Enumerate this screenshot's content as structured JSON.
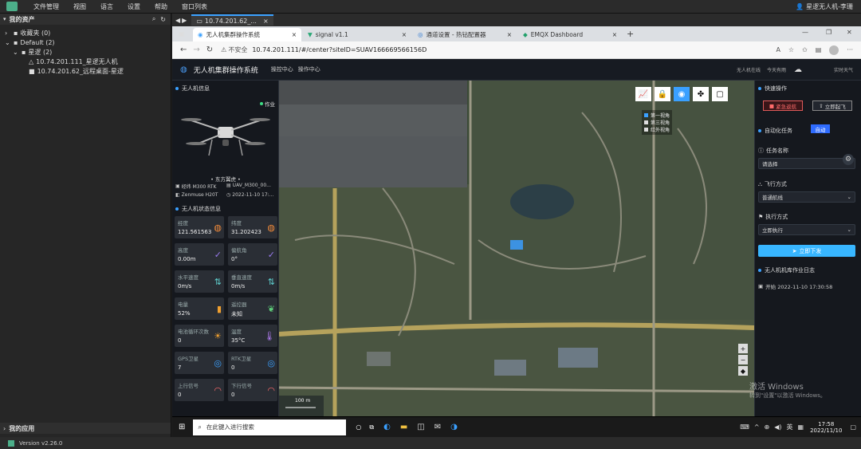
{
  "menubar": {
    "items": [
      "文件管理",
      "视图",
      "语言",
      "设置",
      "帮助",
      "窗口列表"
    ],
    "user": "星逻无人机-李珊"
  },
  "sidebar": {
    "title": "我的资产",
    "tree": [
      {
        "label": "收藏夹 (0)"
      },
      {
        "label": "Default (2)"
      },
      {
        "label": "星逻 (2)"
      },
      {
        "label": "10.74.201.111_星逻无人机"
      },
      {
        "label": "10.74.201.62_远程桌面-星逻"
      }
    ],
    "apps": "我的应用",
    "version": "Version v2.26.0"
  },
  "remote_tab": {
    "label": "10.74.201.62_..."
  },
  "browser": {
    "tabs": [
      "无人机集群操作系统",
      "signal v1.1",
      "通道设置 - 热钻配置器",
      "EMQX Dashboard"
    ],
    "security": "不安全",
    "url": "10.74.201.111/#/center?siteID=SUAV166669566156D"
  },
  "dash": {
    "system_title": "无人机集群操作系统",
    "nav": [
      "操控中心",
      "操作中心"
    ],
    "header_right": [
      "无人机在线",
      "今天有雨",
      "实时天气"
    ],
    "drone_card_title": "无人机信息",
    "status": "作业",
    "drone_name": "• 东方翼虎 •",
    "specs": [
      "经纬 M300 RTK",
      "UAV_M300_00...",
      "Zenmuse H20T",
      "2022-11-10 17:..."
    ],
    "telemetry_title": "无人机状态信息",
    "tiles": [
      {
        "label": "经度",
        "value": "121.561563"
      },
      {
        "label": "纬度",
        "value": "31.202423"
      },
      {
        "label": "高度",
        "value": "0.00m"
      },
      {
        "label": "偏航角",
        "value": "0°"
      },
      {
        "label": "水平速度",
        "value": "0m/s"
      },
      {
        "label": "垂直速度",
        "value": "0m/s"
      },
      {
        "label": "电量",
        "value": "52%"
      },
      {
        "label": "遥控器",
        "value": "未知"
      },
      {
        "label": "电池循环次数",
        "value": "0"
      },
      {
        "label": "温度",
        "value": "35°C"
      },
      {
        "label": "GPS卫星",
        "value": "7"
      },
      {
        "label": "RTK卫星",
        "value": "0"
      },
      {
        "label": "上行信号",
        "value": "0"
      },
      {
        "label": "下行信号",
        "value": "0"
      }
    ],
    "layers": [
      "第一视角",
      "第三视角",
      "红外视角"
    ],
    "scale": "100 m",
    "right": {
      "ops_title": "快速操作",
      "btn_emergency": "紧急返航",
      "btn_takeoff": "立即起飞",
      "auto_title": "自动化任务",
      "auto_btn": "自动",
      "task_label": "任务名称",
      "task_select": "请选择",
      "flight_label": "飞行方式",
      "flight_select": "普通航线",
      "exec_label": "执行方式",
      "exec_select": "立即执行",
      "dispatch": "立即下发",
      "log_title": "无人机机库作业日志",
      "log_entry": "开始 2022-11-10 17:30:58"
    }
  },
  "watermark": {
    "line1": "激活 Windows",
    "line2": "转到\"设置\"以激活 Windows。"
  },
  "taskbar": {
    "search": "在此键入进行搜索",
    "ime": "英",
    "time": "17:58",
    "date": "2022/11/10"
  }
}
